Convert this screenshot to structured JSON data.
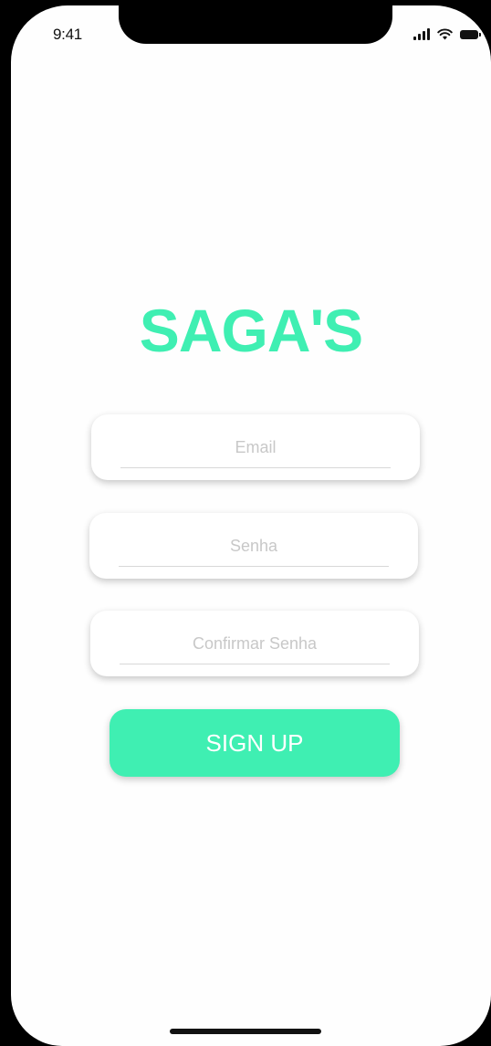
{
  "status_bar": {
    "time": "9:41",
    "icons": [
      "signal-icon",
      "wifi-icon",
      "battery-icon"
    ]
  },
  "app": {
    "title": "SAGA'S"
  },
  "form": {
    "email_placeholder": "Email",
    "password_placeholder": "Senha",
    "confirm_password_placeholder": "Confirmar Senha",
    "submit_label": "SIGN UP"
  },
  "colors": {
    "accent": "#3fefb2",
    "background": "#fefefe",
    "placeholder": "#c8c8c8"
  }
}
